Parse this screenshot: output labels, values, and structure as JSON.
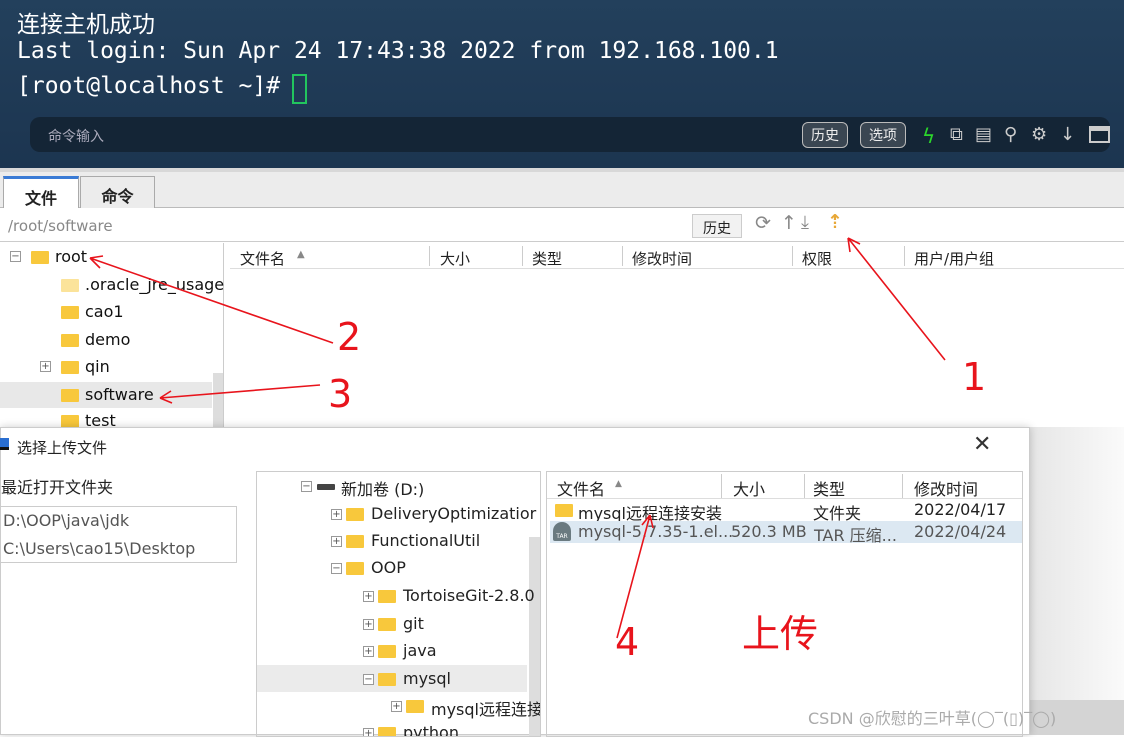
{
  "terminal": {
    "lines": [
      "连接主机成功",
      "Last login: Sun Apr 24 17:43:38 2022 from 192.168.100.1",
      "[root@localhost ~]# "
    ],
    "command_placeholder": "命令输入",
    "history_label": "历史",
    "options_label": "选项",
    "icons": [
      "lightning-icon",
      "copy-icon",
      "paste-icon",
      "search-icon",
      "gear-icon",
      "arrow-down-icon",
      "window-icon"
    ]
  },
  "tabs": [
    {
      "label": "文件",
      "active": true
    },
    {
      "label": "命令",
      "active": false
    }
  ],
  "path": {
    "value": "/root/software",
    "history_label": "历史",
    "icons": [
      "refresh-icon",
      "up-dir-icon",
      "download-icon",
      "upload-icon"
    ]
  },
  "remote_tree": [
    {
      "label": "root",
      "expanded": true
    },
    {
      "label": ".oracle_jre_usage"
    },
    {
      "label": "cao1"
    },
    {
      "label": "demo"
    },
    {
      "label": "qin",
      "expandable": true
    },
    {
      "label": "software",
      "selected": true
    },
    {
      "label": "test"
    }
  ],
  "remote_columns": [
    "文件名",
    "大小",
    "类型",
    "修改时间",
    "权限",
    "用户/用户组"
  ],
  "dialog": {
    "title": "选择上传文件",
    "recent_label": "最近打开文件夹",
    "recent": [
      "D:\\OOP\\java\\jdk",
      "C:\\Users\\cao15\\Desktop"
    ],
    "tree": [
      {
        "label": "新加卷 (D:)",
        "level": 0,
        "state": "minus"
      },
      {
        "label": "DeliveryOptimizatior",
        "level": 1,
        "state": "plus"
      },
      {
        "label": "FunctionalUtil",
        "level": 1,
        "state": "plus"
      },
      {
        "label": "OOP",
        "level": 1,
        "state": "minus"
      },
      {
        "label": "TortoiseGit-2.8.0",
        "level": 2,
        "state": "plus"
      },
      {
        "label": "git",
        "level": 2,
        "state": "plus"
      },
      {
        "label": "java",
        "level": 2,
        "state": "plus"
      },
      {
        "label": "mysql",
        "level": 2,
        "state": "minus",
        "selected": true
      },
      {
        "label": "mysql远程连接",
        "level": 3,
        "state": "plus"
      },
      {
        "label": "python",
        "level": 2,
        "state": "plus"
      }
    ],
    "columns": [
      "文件名",
      "大小",
      "类型",
      "修改时间"
    ],
    "files": [
      {
        "name": "mysql远程连接安装",
        "size": "",
        "type": "文件夹",
        "modified": "2022/04/17",
        "icon": "folder-icon"
      },
      {
        "name": "mysql-5.7.35-1.el...",
        "size": "520.3 MB",
        "type": "TAR 压缩...",
        "modified": "2022/04/24",
        "icon": "tar-archive-icon",
        "selected": true
      }
    ]
  },
  "annotations": {
    "n1": "1",
    "n2": "2",
    "n3": "3",
    "n4": "4",
    "upload": "上传"
  },
  "watermark": "CSDN @欣慰的三叶草(◯‾(▯)‾◯)",
  "colors": {
    "terminal_bg": "#1f3a56",
    "cursor": "#22c55e",
    "annotation": "#e8141c",
    "upload_icon": "#e8a838",
    "selection": "#dce8f2"
  }
}
